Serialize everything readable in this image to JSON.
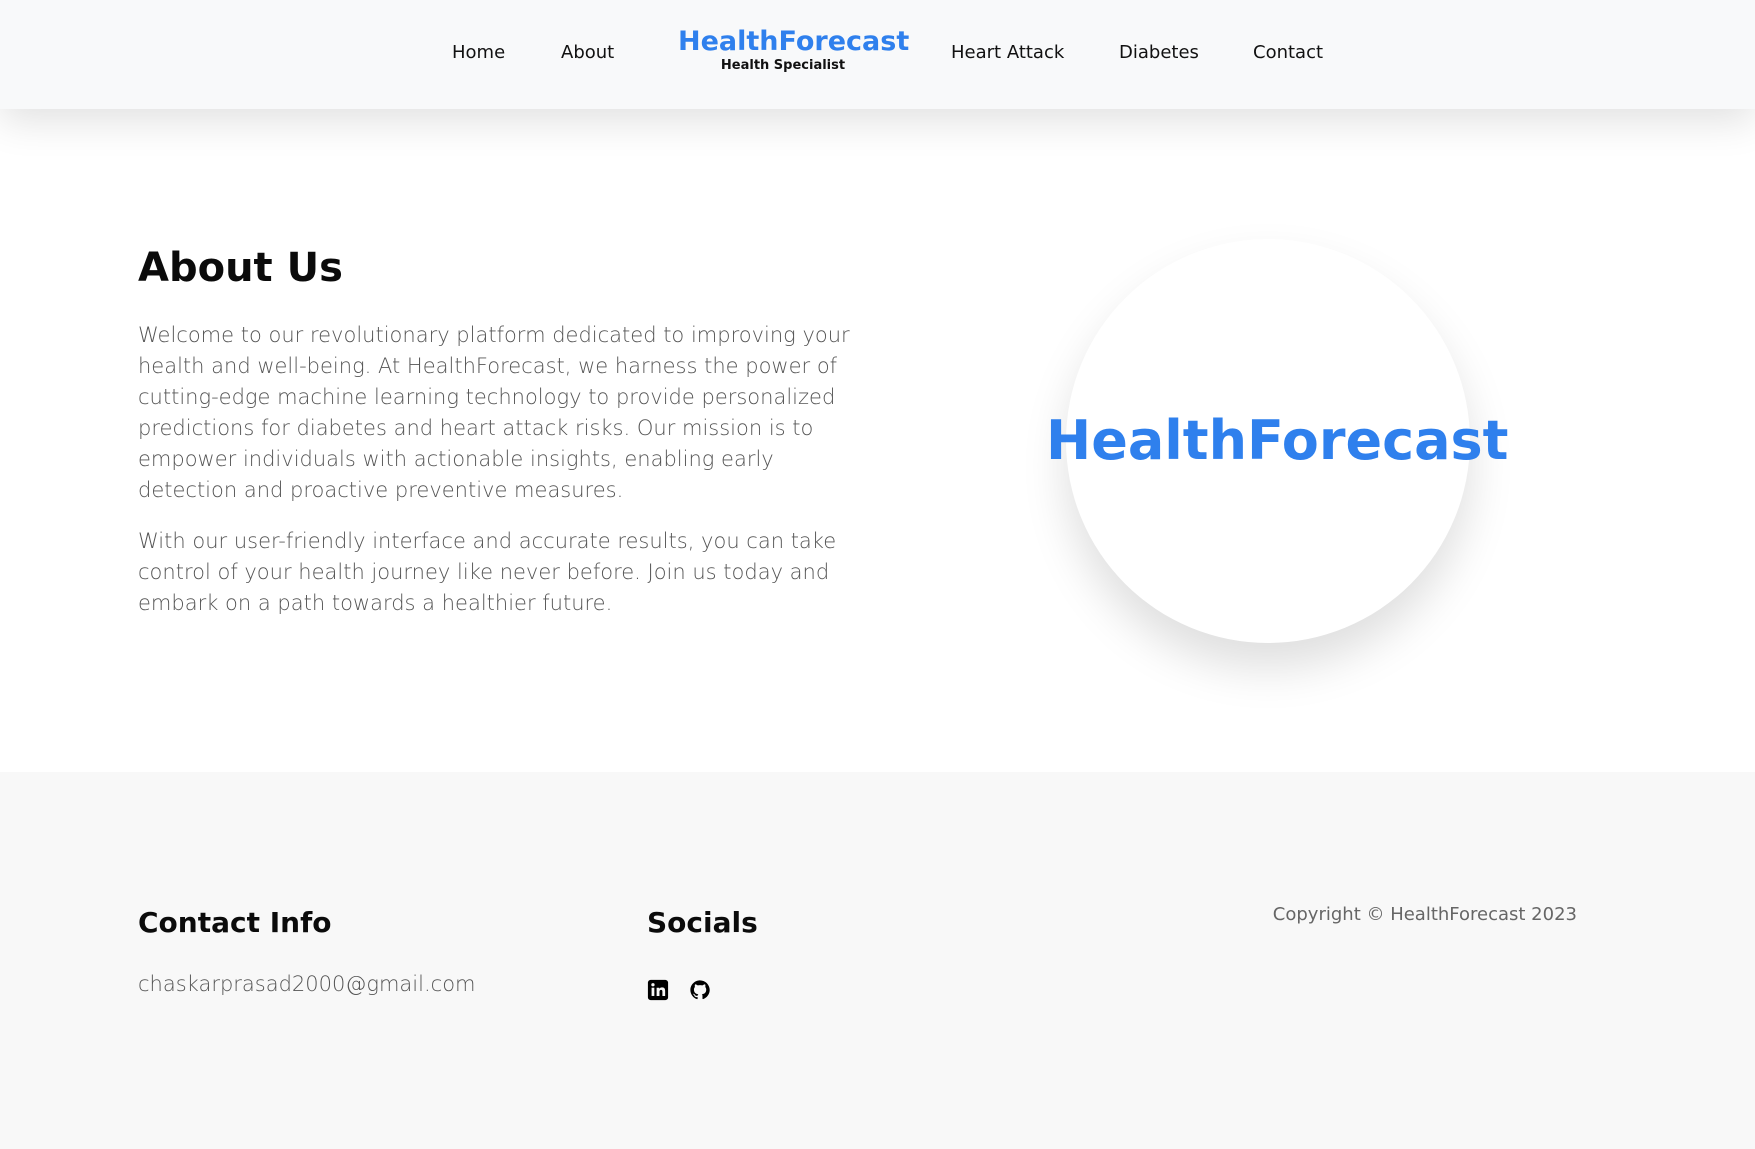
{
  "nav": {
    "home": "Home",
    "about": "About",
    "brand_title": "HealthForecast",
    "brand_subtitle": "Health Specialist",
    "heart_attack": "Heart Attack",
    "diabetes": "Diabetes",
    "contact": "Contact"
  },
  "about": {
    "heading": "About Us",
    "paragraph1": "Welcome to our revolutionary platform dedicated to improving your health and well-being. At HealthForecast, we harness the power of cutting-edge machine learning technology to provide personalized predictions for diabetes and heart attack risks. Our mission is to empower individuals with actionable insights, enabling early detection and proactive preventive measures.",
    "paragraph2": "With our user-friendly interface and accurate results, you can take control of your health journey like never before. Join us today and embark on a path towards a healthier future.",
    "logo_text": "HealthForecast"
  },
  "footer": {
    "contact_heading": "Contact Info",
    "email": "chaskarprasad2000@gmail.com",
    "socials_heading": "Socials",
    "social_icons": [
      "linkedin-icon",
      "github-icon"
    ],
    "copyright": "Copyright © HealthForecast 2023"
  },
  "colors": {
    "brand_blue": "#2f80ed",
    "navbar_bg": "#f8f9fa",
    "footer_bg": "#f8f8f8"
  }
}
